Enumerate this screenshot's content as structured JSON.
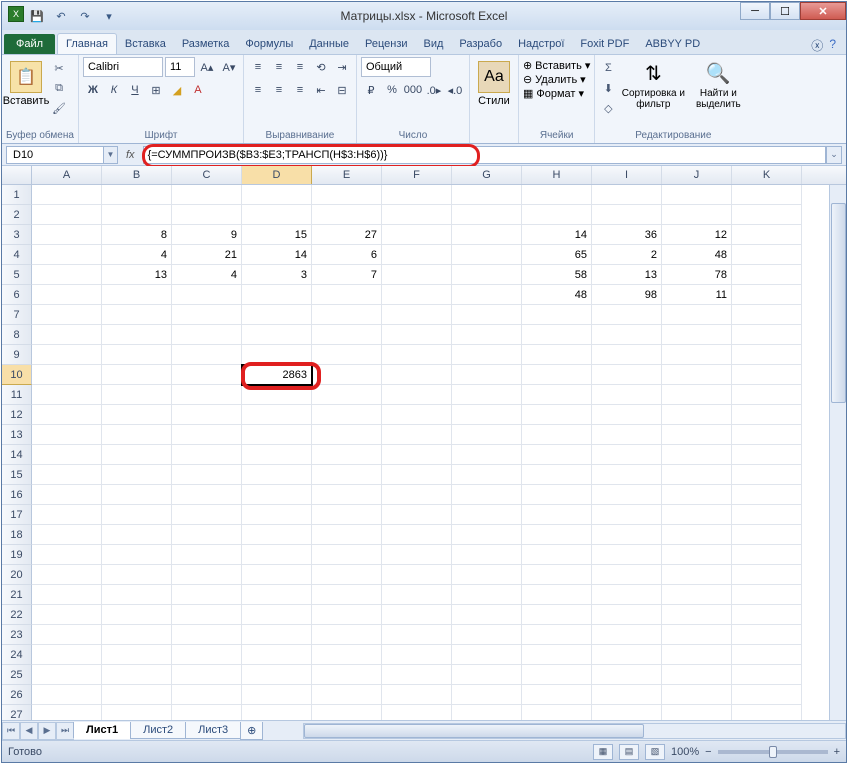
{
  "title": "Матрицы.xlsx - Microsoft Excel",
  "qat": {
    "save": "💾",
    "undo": "↶",
    "redo": "↷"
  },
  "tabs": {
    "file": "Файл",
    "items": [
      "Главная",
      "Вставка",
      "Разметка",
      "Формулы",
      "Данные",
      "Рецензи",
      "Вид",
      "Разрабо",
      "Надстрої",
      "Foxit PDF",
      "ABBYY PD"
    ],
    "active": 0
  },
  "ribbon": {
    "clipboard": {
      "paste": "Вставить",
      "label": "Буфер обмена"
    },
    "font": {
      "name": "Calibri",
      "size": "11",
      "label": "Шрифт"
    },
    "align": {
      "label": "Выравнивание"
    },
    "number": {
      "format": "Общий",
      "label": "Число"
    },
    "styles": {
      "btn": "Стили"
    },
    "cells": {
      "insert": "Вставить",
      "delete": "Удалить",
      "format": "Формат",
      "label": "Ячейки"
    },
    "editing": {
      "sort": "Сортировка и фильтр",
      "find": "Найти и выделить",
      "label": "Редактирование"
    }
  },
  "namebox": "D10",
  "formula": "{=СУММПРОИЗВ($B3:$E3;ТРАНСП(H$3:H$6))}",
  "columns": [
    "A",
    "B",
    "C",
    "D",
    "E",
    "F",
    "G",
    "H",
    "I",
    "J",
    "K"
  ],
  "selected_col": "D",
  "selected_row": 10,
  "cells": {
    "r3": {
      "B": "8",
      "C": "9",
      "D": "15",
      "E": "27",
      "H": "14",
      "I": "36",
      "J": "12"
    },
    "r4": {
      "B": "4",
      "C": "21",
      "D": "14",
      "E": "6",
      "H": "65",
      "I": "2",
      "J": "48"
    },
    "r5": {
      "B": "13",
      "C": "4",
      "D": "3",
      "E": "7",
      "H": "58",
      "I": "13",
      "J": "78"
    },
    "r6": {
      "H": "48",
      "I": "98",
      "J": "11"
    },
    "r10": {
      "D": "2863"
    }
  },
  "sheets": {
    "items": [
      "Лист1",
      "Лист2",
      "Лист3"
    ],
    "active": 0
  },
  "status": {
    "ready": "Готово",
    "zoom": "100%"
  }
}
